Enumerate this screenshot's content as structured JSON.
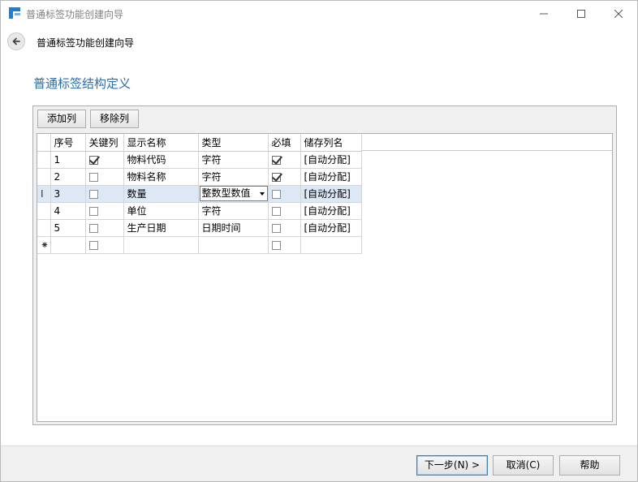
{
  "window": {
    "title": "普通标签功能创建向导",
    "controls": {
      "minimize": "—",
      "maximize": "☐",
      "close": "✕"
    },
    "icons": {
      "app": "app-logo-icon",
      "back": "back-arrow-icon"
    }
  },
  "nav": {
    "title": "普通标签功能创建向导"
  },
  "page": {
    "heading": "普通标签结构定义"
  },
  "toolbar": {
    "add_label": "添加列",
    "remove_label": "移除列"
  },
  "grid": {
    "columns": [
      "序号",
      "关键列",
      "显示名称",
      "类型",
      "必填",
      "储存列名"
    ],
    "rows": [
      {
        "indicator": "",
        "seq": "1",
        "key": true,
        "name": "物料代码",
        "type": "字符",
        "required": true,
        "storage": "[自动分配]",
        "selected": false,
        "editing": false
      },
      {
        "indicator": "",
        "seq": "2",
        "key": false,
        "name": "物料名称",
        "type": "字符",
        "required": true,
        "storage": "[自动分配]",
        "selected": false,
        "editing": false
      },
      {
        "indicator": "I",
        "seq": "3",
        "key": false,
        "name": "数量",
        "type": "整数型数值",
        "required": false,
        "storage": "[自动分配]",
        "selected": true,
        "editing": true
      },
      {
        "indicator": "",
        "seq": "4",
        "key": false,
        "name": "单位",
        "type": "字符",
        "required": false,
        "storage": "[自动分配]",
        "selected": false,
        "editing": false
      },
      {
        "indicator": "",
        "seq": "5",
        "key": false,
        "name": "生产日期",
        "type": "日期时间",
        "required": false,
        "storage": "[自动分配]",
        "selected": false,
        "editing": false
      }
    ],
    "new_row": {
      "indicator": "⁕",
      "seq": "",
      "key": false,
      "name": "",
      "type": "",
      "required": false,
      "storage": ""
    }
  },
  "footer": {
    "next_label": "下一步(N) >",
    "cancel_label": "取消(C)",
    "help_label": "帮助"
  },
  "colors": {
    "heading": "#2a6db0",
    "selected_row": "#dde8f7",
    "app_icon": "#1e7fd2"
  }
}
